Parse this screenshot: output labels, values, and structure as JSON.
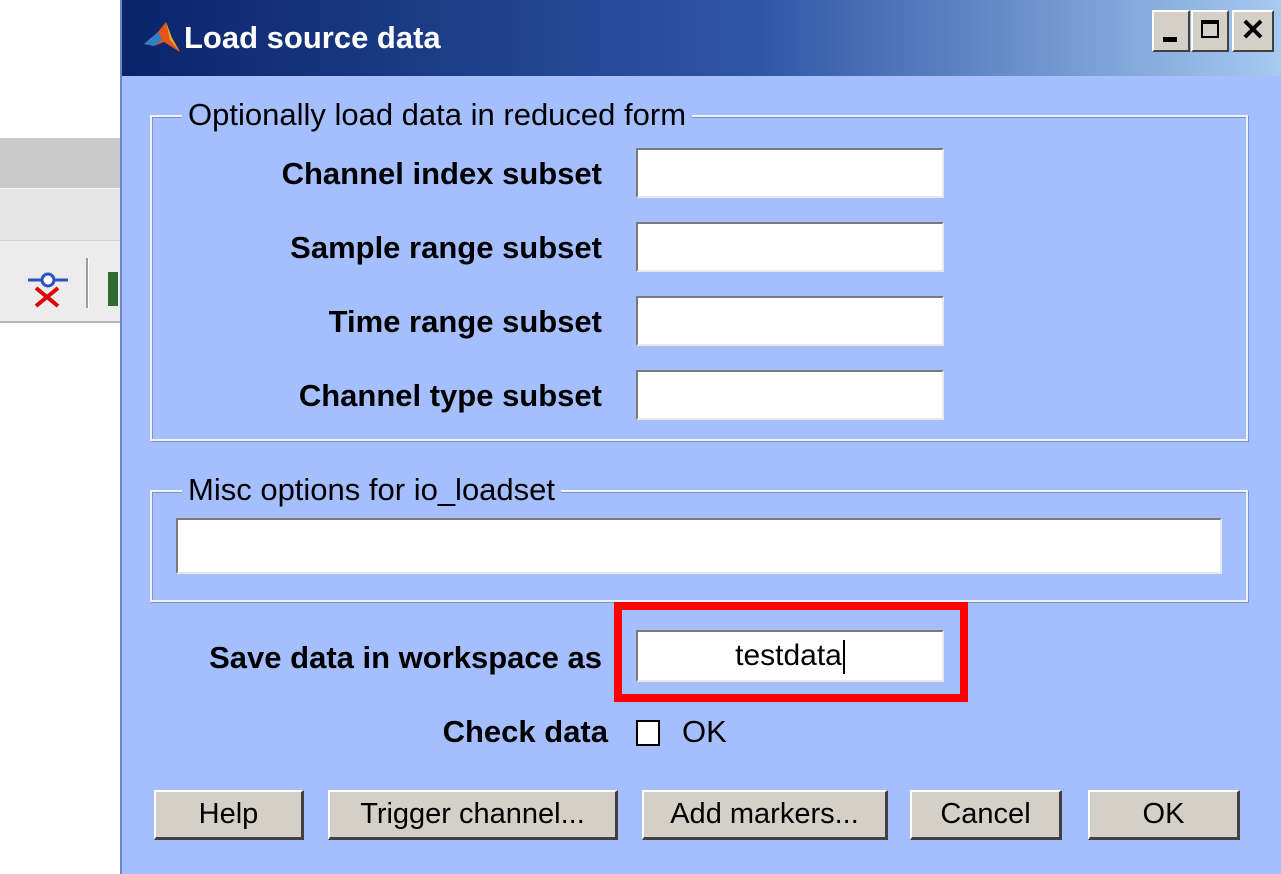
{
  "dialog": {
    "title": "Load source data",
    "title_icon": "matlab-membrane-icon"
  },
  "reduced_form_group": {
    "legend": "Optionally load data in reduced form",
    "fields": [
      {
        "label": "Channel index subset",
        "value": ""
      },
      {
        "label": "Sample range subset",
        "value": ""
      },
      {
        "label": "Time range subset",
        "value": ""
      },
      {
        "label": "Channel type subset",
        "value": ""
      }
    ]
  },
  "misc_group": {
    "legend": "Misc options for io_loadset",
    "value": ""
  },
  "save_as": {
    "label": "Save data in workspace as",
    "value": "testdata"
  },
  "check_data": {
    "label": "Check data",
    "checkbox_label": "OK",
    "checked": false
  },
  "buttons": {
    "help": "Help",
    "trigger_channel": "Trigger channel...",
    "add_markers": "Add markers...",
    "cancel": "Cancel",
    "ok": "OK"
  },
  "colors": {
    "dialog_background": "#a5bffe",
    "titlebar_start": "#0a246a",
    "titlebar_end": "#a6caf0",
    "highlight": "#ff0000"
  }
}
